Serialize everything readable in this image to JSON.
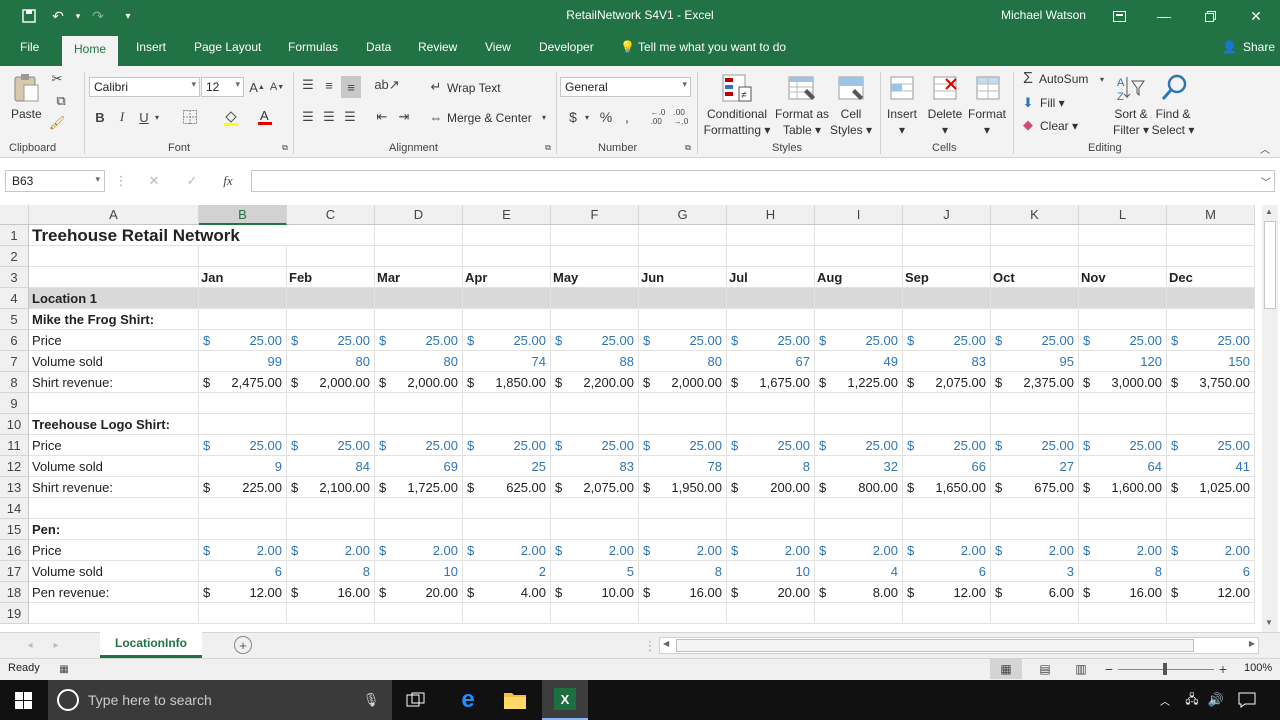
{
  "window": {
    "title": "RetailNetwork S4V1  -  Excel",
    "user": "Michael Watson"
  },
  "tabs": [
    "File",
    "Home",
    "Insert",
    "Page Layout",
    "Formulas",
    "Data",
    "Review",
    "View",
    "Developer"
  ],
  "tell_me": "Tell me what you want to do",
  "share": "Share",
  "ribbon": {
    "clipboard": {
      "paste": "Paste",
      "label": "Clipboard"
    },
    "font": {
      "name": "Calibri",
      "size": "12",
      "bold": "B",
      "italic": "I",
      "underline": "U",
      "label": "Font"
    },
    "alignment": {
      "wrap": "Wrap Text",
      "merge": "Merge & Center",
      "label": "Alignment"
    },
    "number": {
      "format": "General",
      "dollar": "$",
      "percent": "%",
      "comma": ",",
      "label": "Number"
    },
    "styles": {
      "cond1": "Conditional",
      "cond2": "Formatting",
      "fmt1": "Format as",
      "fmt2": "Table",
      "cell1": "Cell",
      "cell2": "Styles",
      "label": "Styles"
    },
    "cells": {
      "insert": "Insert",
      "delete": "Delete",
      "format": "Format",
      "label": "Cells"
    },
    "editing": {
      "autosum": "AutoSum",
      "fill": "Fill",
      "clear": "Clear",
      "sort1": "Sort &",
      "sort2": "Filter",
      "find1": "Find &",
      "find2": "Select",
      "label": "Editing"
    }
  },
  "formula_bar": {
    "name_box": "B63",
    "fx": "fx",
    "formula": ""
  },
  "columns": [
    "A",
    "B",
    "C",
    "D",
    "E",
    "F",
    "G",
    "H",
    "I",
    "J",
    "K",
    "L",
    "M"
  ],
  "selected_column": "B",
  "rows": [
    {
      "n": "1",
      "a": "Treehouse Retail Network",
      "kind": "title"
    },
    {
      "n": "2",
      "a": "",
      "kind": "blank"
    },
    {
      "n": "3",
      "a": "",
      "kind": "months",
      "vals": [
        "Jan",
        "Feb",
        "Mar",
        "Apr",
        "May",
        "Jun",
        "Jul",
        "Aug",
        "Sep",
        "Oct",
        "Nov",
        "Dec"
      ]
    },
    {
      "n": "4",
      "a": "Location 1",
      "kind": "location"
    },
    {
      "n": "5",
      "a": "Mike the Frog Shirt:",
      "kind": "header"
    },
    {
      "n": "6",
      "a": "Price",
      "kind": "price",
      "vals": [
        "25.00",
        "25.00",
        "25.00",
        "25.00",
        "25.00",
        "25.00",
        "25.00",
        "25.00",
        "25.00",
        "25.00",
        "25.00",
        "25.00"
      ]
    },
    {
      "n": "7",
      "a": "Volume sold",
      "kind": "volume",
      "vals": [
        "99",
        "80",
        "80",
        "74",
        "88",
        "80",
        "67",
        "49",
        "83",
        "95",
        "120",
        "150"
      ]
    },
    {
      "n": "8",
      "a": "Shirt revenue:",
      "kind": "revenue",
      "vals": [
        "2,475.00",
        "2,000.00",
        "2,000.00",
        "1,850.00",
        "2,200.00",
        "2,000.00",
        "1,675.00",
        "1,225.00",
        "2,075.00",
        "2,375.00",
        "3,000.00",
        "3,750.00"
      ]
    },
    {
      "n": "9",
      "a": "",
      "kind": "blank"
    },
    {
      "n": "10",
      "a": "Treehouse Logo Shirt:",
      "kind": "header"
    },
    {
      "n": "11",
      "a": "Price",
      "kind": "price",
      "vals": [
        "25.00",
        "25.00",
        "25.00",
        "25.00",
        "25.00",
        "25.00",
        "25.00",
        "25.00",
        "25.00",
        "25.00",
        "25.00",
        "25.00"
      ]
    },
    {
      "n": "12",
      "a": "Volume sold",
      "kind": "volume",
      "vals": [
        "9",
        "84",
        "69",
        "25",
        "83",
        "78",
        "8",
        "32",
        "66",
        "27",
        "64",
        "41"
      ]
    },
    {
      "n": "13",
      "a": "Shirt revenue:",
      "kind": "revenue",
      "vals": [
        "225.00",
        "2,100.00",
        "1,725.00",
        "625.00",
        "2,075.00",
        "1,950.00",
        "200.00",
        "800.00",
        "1,650.00",
        "675.00",
        "1,600.00",
        "1,025.00"
      ]
    },
    {
      "n": "14",
      "a": "",
      "kind": "blank"
    },
    {
      "n": "15",
      "a": "Pen:",
      "kind": "header"
    },
    {
      "n": "16",
      "a": "Price",
      "kind": "price",
      "vals": [
        "2.00",
        "2.00",
        "2.00",
        "2.00",
        "2.00",
        "2.00",
        "2.00",
        "2.00",
        "2.00",
        "2.00",
        "2.00",
        "2.00"
      ]
    },
    {
      "n": "17",
      "a": "Volume sold",
      "kind": "volume",
      "vals": [
        "6",
        "8",
        "10",
        "2",
        "5",
        "8",
        "10",
        "4",
        "6",
        "3",
        "8",
        "6"
      ]
    },
    {
      "n": "18",
      "a": "Pen revenue:",
      "kind": "revenue",
      "vals": [
        "12.00",
        "16.00",
        "20.00",
        "4.00",
        "10.00",
        "16.00",
        "20.00",
        "8.00",
        "12.00",
        "6.00",
        "16.00",
        "12.00"
      ]
    },
    {
      "n": "19",
      "a": "",
      "kind": "blank"
    }
  ],
  "currency_symbol": "$",
  "sheet_tab": "LocationInfo",
  "status": {
    "ready": "Ready",
    "zoom": "100%"
  },
  "taskbar": {
    "search_placeholder": "Type here to search"
  },
  "colors": {
    "excel_green": "#217346",
    "value_blue": "#2e75b6",
    "location_gray": "#d9d9d9"
  }
}
